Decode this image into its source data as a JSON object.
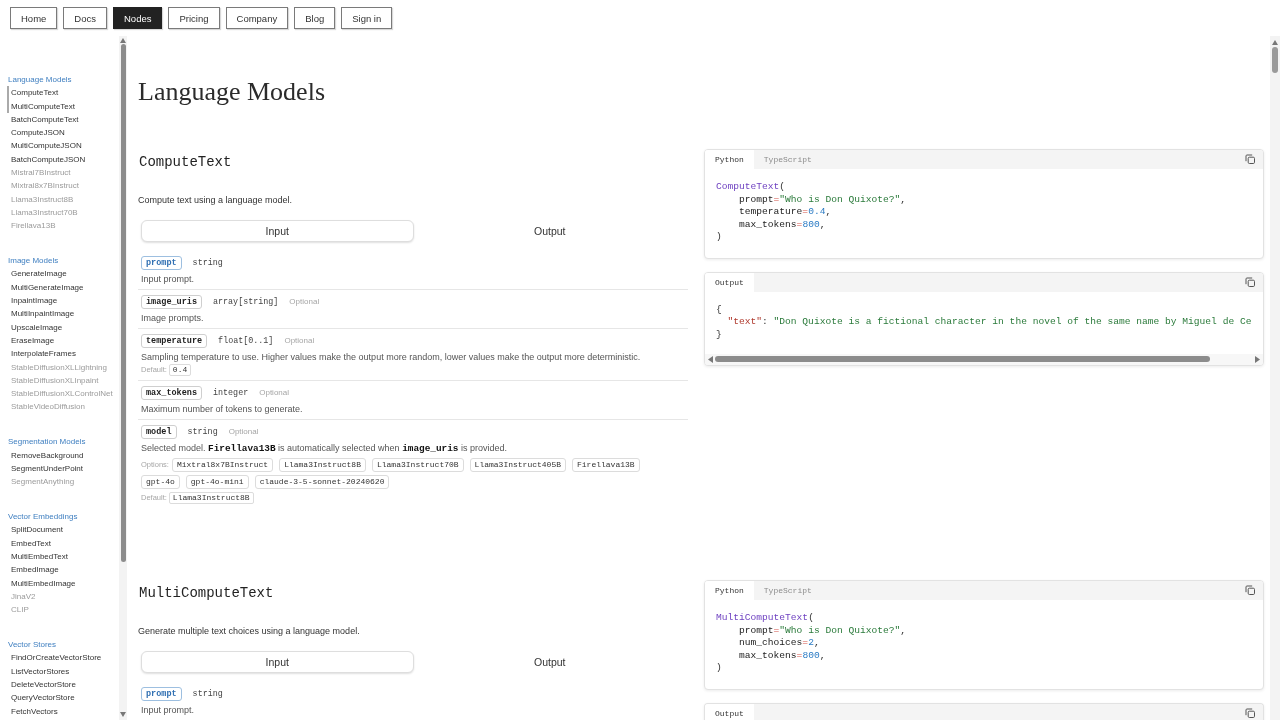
{
  "nav": [
    {
      "label": "Home",
      "selected": false
    },
    {
      "label": "Docs",
      "selected": false
    },
    {
      "label": "Nodes",
      "selected": true
    },
    {
      "label": "Pricing",
      "selected": false
    },
    {
      "label": "Company",
      "selected": false
    },
    {
      "label": "Blog",
      "selected": false
    },
    {
      "label": "Sign in",
      "selected": false
    }
  ],
  "sidebar": {
    "groups": [
      {
        "title": "Language Models",
        "items": [
          {
            "label": "ComputeText",
            "in_view": true,
            "disabled": false
          },
          {
            "label": "MultiComputeText",
            "in_view": true,
            "disabled": false
          },
          {
            "label": "BatchComputeText",
            "in_view": false,
            "disabled": false
          },
          {
            "label": "ComputeJSON",
            "in_view": false,
            "disabled": false
          },
          {
            "label": "MultiComputeJSON",
            "in_view": false,
            "disabled": false
          },
          {
            "label": "BatchComputeJSON",
            "in_view": false,
            "disabled": false
          },
          {
            "label": "Mistral7BInstruct",
            "in_view": false,
            "disabled": true
          },
          {
            "label": "Mixtral8x7BInstruct",
            "in_view": false,
            "disabled": true
          },
          {
            "label": "Llama3Instruct8B",
            "in_view": false,
            "disabled": true
          },
          {
            "label": "Llama3Instruct70B",
            "in_view": false,
            "disabled": true
          },
          {
            "label": "Firellava13B",
            "in_view": false,
            "disabled": true
          }
        ]
      },
      {
        "title": "Image Models",
        "items": [
          {
            "label": "GenerateImage",
            "in_view": false,
            "disabled": false
          },
          {
            "label": "MultiGenerateImage",
            "in_view": false,
            "disabled": false
          },
          {
            "label": "InpaintImage",
            "in_view": false,
            "disabled": false
          },
          {
            "label": "MultiInpaintImage",
            "in_view": false,
            "disabled": false
          },
          {
            "label": "UpscaleImage",
            "in_view": false,
            "disabled": false
          },
          {
            "label": "EraseImage",
            "in_view": false,
            "disabled": false
          },
          {
            "label": "InterpolateFrames",
            "in_view": false,
            "disabled": false
          },
          {
            "label": "StableDiffusionXLLightning",
            "in_view": false,
            "disabled": true
          },
          {
            "label": "StableDiffusionXLInpaint",
            "in_view": false,
            "disabled": true
          },
          {
            "label": "StableDiffusionXLControlNet",
            "in_view": false,
            "disabled": true
          },
          {
            "label": "StableVideoDiffusion",
            "in_view": false,
            "disabled": true
          }
        ]
      },
      {
        "title": "Segmentation Models",
        "items": [
          {
            "label": "RemoveBackground",
            "in_view": false,
            "disabled": false
          },
          {
            "label": "SegmentUnderPoint",
            "in_view": false,
            "disabled": false
          },
          {
            "label": "SegmentAnything",
            "in_view": false,
            "disabled": true
          }
        ]
      },
      {
        "title": "Vector Embeddings",
        "items": [
          {
            "label": "SplitDocument",
            "in_view": false,
            "disabled": false
          },
          {
            "label": "EmbedText",
            "in_view": false,
            "disabled": false
          },
          {
            "label": "MultiEmbedText",
            "in_view": false,
            "disabled": false
          },
          {
            "label": "EmbedImage",
            "in_view": false,
            "disabled": false
          },
          {
            "label": "MultiEmbedImage",
            "in_view": false,
            "disabled": false
          },
          {
            "label": "JinaV2",
            "in_view": false,
            "disabled": true
          },
          {
            "label": "CLIP",
            "in_view": false,
            "disabled": true
          }
        ]
      },
      {
        "title": "Vector Stores",
        "items": [
          {
            "label": "FindOrCreateVectorStore",
            "in_view": false,
            "disabled": false
          },
          {
            "label": "ListVectorStores",
            "in_view": false,
            "disabled": false
          },
          {
            "label": "DeleteVectorStore",
            "in_view": false,
            "disabled": false
          },
          {
            "label": "QueryVectorStore",
            "in_view": false,
            "disabled": false
          },
          {
            "label": "FetchVectors",
            "in_view": false,
            "disabled": false
          }
        ]
      }
    ]
  },
  "page": {
    "title": "Language Models"
  },
  "sections": [
    {
      "name": "ComputeText",
      "description": "Compute text using a language model.",
      "tabs": [
        {
          "label": "Input",
          "selected": true
        },
        {
          "label": "Output",
          "selected": false
        }
      ],
      "params": [
        {
          "name": "prompt",
          "required": true,
          "type": "string",
          "description": "Input prompt."
        },
        {
          "name": "image_uris",
          "required": false,
          "type": "array[string]",
          "note": "Optional",
          "description": "Image prompts."
        },
        {
          "name": "temperature",
          "required": false,
          "type": "float[0..1]",
          "note": "Optional",
          "description": "Sampling temperature to use. Higher values make the output more random, lower values make the output more deterministic.",
          "default": {
            "label": "Default:",
            "value": "0.4"
          }
        },
        {
          "name": "max_tokens",
          "required": false,
          "type": "integer",
          "note": "Optional",
          "description": "Maximum number of tokens to generate."
        },
        {
          "name": "model",
          "required": false,
          "type": "string",
          "note": "Optional",
          "description": "Selected model. **Firellava13B** is automatically selected when **image_uris** is provided.",
          "options": {
            "label": "Options:",
            "values": [
              "Mixtral8x7BInstruct",
              "Llama3Instruct8B",
              "Llama3Instruct70B",
              "Llama3Instruct405B",
              "Firellava13B",
              "gpt-4o",
              "gpt-4o-mini",
              "claude-3-5-sonnet-20240620"
            ]
          },
          "default": {
            "label": "Default:",
            "value": "Llama3Instruct8B"
          }
        }
      ],
      "code": {
        "tabs": [
          {
            "label": "Python",
            "selected": true
          },
          {
            "label": "TypeScript",
            "selected": false
          }
        ],
        "lines": [
          [
            {
              "kind": "fn",
              "text": "ComputeText"
            },
            {
              "kind": "punct",
              "text": "("
            }
          ],
          [
            {
              "kind": "plain",
              "text": "    prompt"
            },
            {
              "kind": "op",
              "text": "="
            },
            {
              "kind": "str",
              "text": "\"Who is Don Quixote?\""
            },
            {
              "kind": "punct",
              "text": ","
            }
          ],
          [
            {
              "kind": "plain",
              "text": "    temperature"
            },
            {
              "kind": "op",
              "text": "="
            },
            {
              "kind": "num",
              "text": "0.4"
            },
            {
              "kind": "punct",
              "text": ","
            }
          ],
          [
            {
              "kind": "plain",
              "text": "    max_tokens"
            },
            {
              "kind": "op",
              "text": "="
            },
            {
              "kind": "num",
              "text": "800"
            },
            {
              "kind": "punct",
              "text": ","
            }
          ],
          [
            {
              "kind": "punct",
              "text": ")"
            }
          ]
        ]
      },
      "output": {
        "tabs": [
          {
            "label": "Output",
            "selected": true
          }
        ],
        "lines": [
          [
            {
              "kind": "punct",
              "text": "{"
            }
          ],
          [
            {
              "kind": "key",
              "text": "  \"text\""
            },
            {
              "kind": "punct",
              "text": ": "
            },
            {
              "kind": "str",
              "text": "\"Don Quixote is a fictional character in the novel of the same name by Miguel de Ce"
            }
          ],
          [
            {
              "kind": "punct",
              "text": "}"
            }
          ]
        ]
      }
    },
    {
      "name": "MultiComputeText",
      "description": "Generate multiple text choices using a language model.",
      "tabs": [
        {
          "label": "Input",
          "selected": true
        },
        {
          "label": "Output",
          "selected": false
        }
      ],
      "params": [
        {
          "name": "prompt",
          "required": true,
          "type": "string",
          "description": "Input prompt."
        }
      ],
      "code": {
        "tabs": [
          {
            "label": "Python",
            "selected": true
          },
          {
            "label": "TypeScript",
            "selected": false
          }
        ],
        "lines": [
          [
            {
              "kind": "fn",
              "text": "MultiComputeText"
            },
            {
              "kind": "punct",
              "text": "("
            }
          ],
          [
            {
              "kind": "plain",
              "text": "    prompt"
            },
            {
              "kind": "op",
              "text": "="
            },
            {
              "kind": "str",
              "text": "\"Who is Don Quixote?\""
            },
            {
              "kind": "punct",
              "text": ","
            }
          ],
          [
            {
              "kind": "plain",
              "text": "    num_choices"
            },
            {
              "kind": "op",
              "text": "="
            },
            {
              "kind": "num",
              "text": "2"
            },
            {
              "kind": "punct",
              "text": ","
            }
          ],
          [
            {
              "kind": "plain",
              "text": "    max_tokens"
            },
            {
              "kind": "op",
              "text": "="
            },
            {
              "kind": "num",
              "text": "800"
            },
            {
              "kind": "punct",
              "text": ","
            }
          ],
          [
            {
              "kind": "punct",
              "text": ")"
            }
          ]
        ]
      },
      "output": {
        "tabs": [
          {
            "label": "Output",
            "selected": true
          }
        ]
      }
    }
  ]
}
